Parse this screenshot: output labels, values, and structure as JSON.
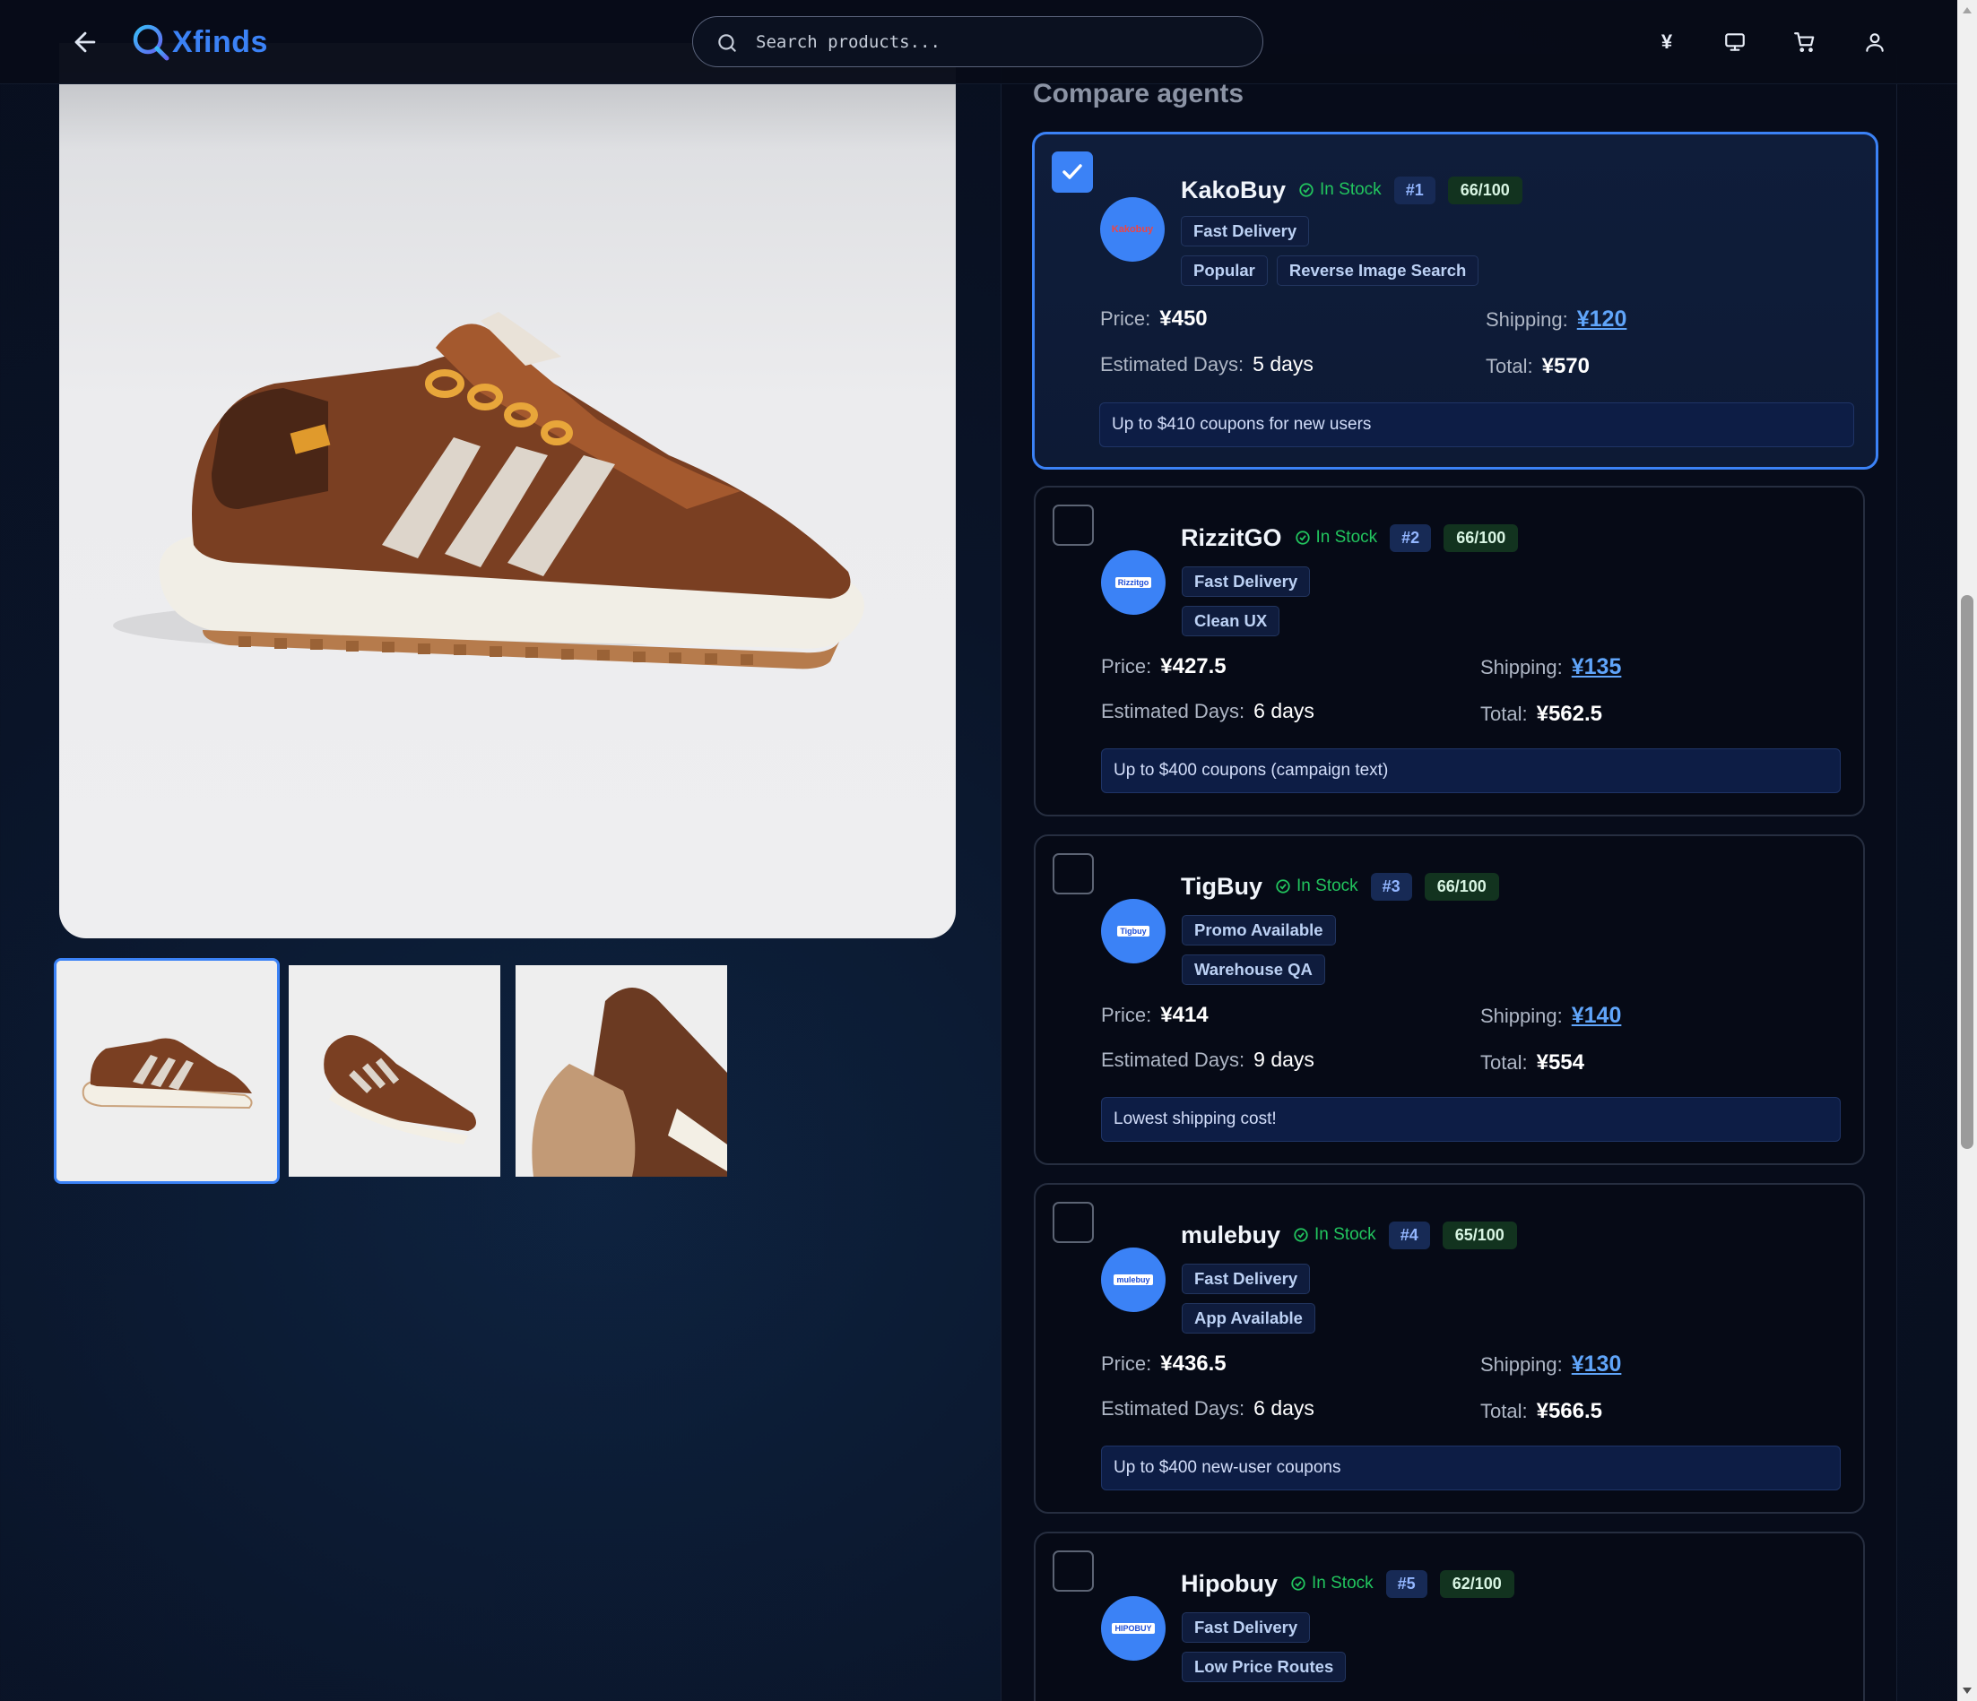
{
  "header": {
    "brand": "Xfinds",
    "search_placeholder": "Search products...",
    "currency_symbol": "¥"
  },
  "colors": {
    "accent": "#3b82f6",
    "in_stock": "#22c55e",
    "background": "#070b18"
  },
  "gallery": {
    "thumbnails": [
      "shoe-side-view",
      "shoe-angled-view",
      "shoe-back-view"
    ],
    "active_index": 0
  },
  "compare": {
    "title": "Compare agents",
    "agents": [
      {
        "name": "KakoBuy",
        "logo_text": "Kakobuy",
        "selected": true,
        "stock": "In Stock",
        "rank": "#1",
        "score": "66/100",
        "tags_row1": [
          "Fast Delivery"
        ],
        "tags_row2": [
          "Popular",
          "Reverse Image Search"
        ],
        "price_label": "Price:",
        "price": "¥450",
        "shipping_label": "Shipping:",
        "shipping": "¥120",
        "days_label": "Estimated Days:",
        "days": "5 days",
        "total_label": "Total:",
        "total": "¥570",
        "promo": "Up to $410 coupons for new users"
      },
      {
        "name": "RizzitGO",
        "logo_text": "Rizzitgo",
        "selected": false,
        "stock": "In Stock",
        "rank": "#2",
        "score": "66/100",
        "tags_row1": [
          "Fast Delivery"
        ],
        "tags_row2": [
          "Clean UX"
        ],
        "price_label": "Price:",
        "price": "¥427.5",
        "shipping_label": "Shipping:",
        "shipping": "¥135",
        "days_label": "Estimated Days:",
        "days": "6 days",
        "total_label": "Total:",
        "total": "¥562.5",
        "promo": "Up to $400 coupons (campaign text)"
      },
      {
        "name": "TigBuy",
        "logo_text": "Tigbuy",
        "selected": false,
        "stock": "In Stock",
        "rank": "#3",
        "score": "66/100",
        "tags_row1": [
          "Promo Available"
        ],
        "tags_row2": [
          "Warehouse QA"
        ],
        "price_label": "Price:",
        "price": "¥414",
        "shipping_label": "Shipping:",
        "shipping": "¥140",
        "days_label": "Estimated Days:",
        "days": "9 days",
        "total_label": "Total:",
        "total": "¥554",
        "promo": "Lowest shipping cost!"
      },
      {
        "name": "mulebuy",
        "logo_text": "mulebuy",
        "selected": false,
        "stock": "In Stock",
        "rank": "#4",
        "score": "65/100",
        "tags_row1": [
          "Fast Delivery"
        ],
        "tags_row2": [
          "App Available"
        ],
        "price_label": "Price:",
        "price": "¥436.5",
        "shipping_label": "Shipping:",
        "shipping": "¥130",
        "days_label": "Estimated Days:",
        "days": "6 days",
        "total_label": "Total:",
        "total": "¥566.5",
        "promo": "Up to $400 new-user coupons"
      },
      {
        "name": "Hipobuy",
        "logo_text": "HIPOBUY",
        "selected": false,
        "stock": "In Stock",
        "rank": "#5",
        "score": "62/100",
        "tags_row1": [
          "Fast Delivery"
        ],
        "tags_row2": [
          "Low Price Routes"
        ]
      }
    ]
  }
}
